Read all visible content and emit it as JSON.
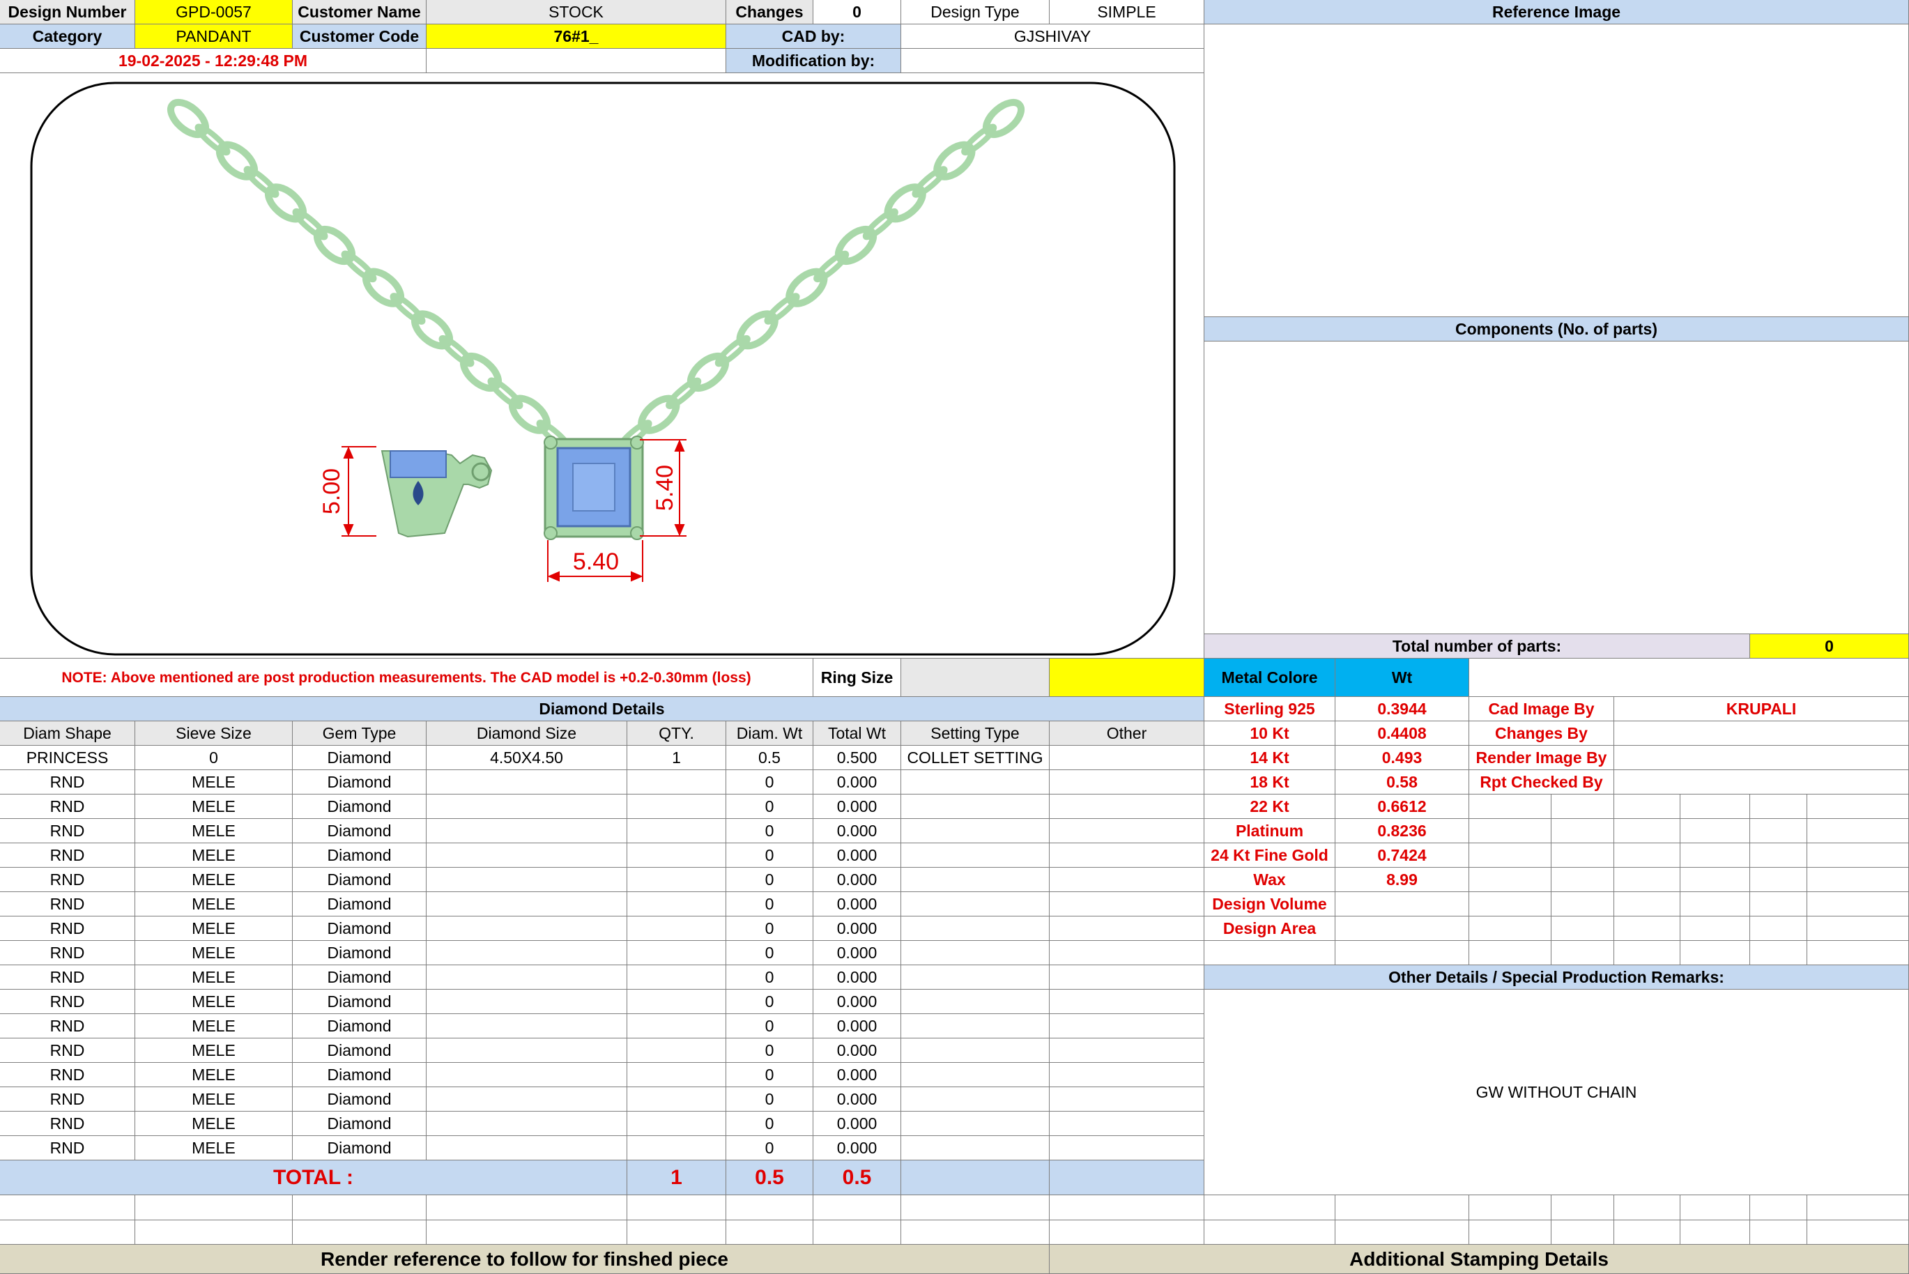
{
  "header": {
    "design_number_label": "Design Number",
    "design_number": "GPD-0057",
    "customer_name_label": "Customer Name",
    "customer_name": "STOCK",
    "changes_label": "Changes",
    "changes": "0",
    "design_type_label": "Design Type",
    "design_type": "SIMPLE",
    "category_label": "Category",
    "category": "PANDANT",
    "customer_code_label": "Customer Code",
    "customer_code": "76#1_",
    "cad_by_label": "CAD by:",
    "cad_by": "GJSHIVAY",
    "timestamp": "19-02-2025 - 12:29:48 PM",
    "modification_label": "Modification by:"
  },
  "drawing": {
    "dim_side": "5.00",
    "dim_height": "5.40",
    "dim_width": "5.40",
    "chain_color": "#a9d8a9",
    "stone_color": "#7aa3e8",
    "dim_color": "#e00000"
  },
  "right": {
    "reference_image": "Reference Image",
    "components": "Components (No. of parts)",
    "total_parts_label": "Total number of parts:",
    "total_parts": "0"
  },
  "note": "NOTE: Above mentioned are post production measurements. The CAD model is +0.2-0.30mm (loss)",
  "ring_size_label": "Ring Size",
  "diamond": {
    "title": "Diamond Details",
    "headers": [
      "Diam Shape",
      "Sieve Size",
      "Gem Type",
      "Diamond Size",
      "QTY.",
      "Diam. Wt",
      "Total Wt",
      "Setting Type",
      "Other"
    ],
    "rows": [
      [
        "PRINCESS",
        "0",
        "Diamond",
        "4.50X4.50",
        "1",
        "0.5",
        "0.500",
        "COLLET SETTING",
        ""
      ],
      [
        "RND",
        "MELE",
        "Diamond",
        "",
        "",
        "0",
        "0.000",
        "",
        ""
      ],
      [
        "RND",
        "MELE",
        "Diamond",
        "",
        "",
        "0",
        "0.000",
        "",
        ""
      ],
      [
        "RND",
        "MELE",
        "Diamond",
        "",
        "",
        "0",
        "0.000",
        "",
        ""
      ],
      [
        "RND",
        "MELE",
        "Diamond",
        "",
        "",
        "0",
        "0.000",
        "",
        ""
      ],
      [
        "RND",
        "MELE",
        "Diamond",
        "",
        "",
        "0",
        "0.000",
        "",
        ""
      ],
      [
        "RND",
        "MELE",
        "Diamond",
        "",
        "",
        "0",
        "0.000",
        "",
        ""
      ],
      [
        "RND",
        "MELE",
        "Diamond",
        "",
        "",
        "0",
        "0.000",
        "",
        ""
      ],
      [
        "RND",
        "MELE",
        "Diamond",
        "",
        "",
        "0",
        "0.000",
        "",
        ""
      ],
      [
        "RND",
        "MELE",
        "Diamond",
        "",
        "",
        "0",
        "0.000",
        "",
        ""
      ],
      [
        "RND",
        "MELE",
        "Diamond",
        "",
        "",
        "0",
        "0.000",
        "",
        ""
      ],
      [
        "RND",
        "MELE",
        "Diamond",
        "",
        "",
        "0",
        "0.000",
        "",
        ""
      ],
      [
        "RND",
        "MELE",
        "Diamond",
        "",
        "",
        "0",
        "0.000",
        "",
        ""
      ],
      [
        "RND",
        "MELE",
        "Diamond",
        "",
        "",
        "0",
        "0.000",
        "",
        ""
      ],
      [
        "RND",
        "MELE",
        "Diamond",
        "",
        "",
        "0",
        "0.000",
        "",
        ""
      ],
      [
        "RND",
        "MELE",
        "Diamond",
        "",
        "",
        "0",
        "0.000",
        "",
        ""
      ],
      [
        "RND",
        "MELE",
        "Diamond",
        "",
        "",
        "0",
        "0.000",
        "",
        ""
      ]
    ],
    "total_label": "TOTAL :",
    "total_qty": "1",
    "total_diam_wt": "0.5",
    "total_wt": "0.5"
  },
  "metal": {
    "header_color": "Metal Colore",
    "header_wt": "Wt",
    "rows": [
      [
        "Sterling 925",
        "0.3944"
      ],
      [
        "10 Kt",
        "0.4408"
      ],
      [
        "14 Kt",
        "0.493"
      ],
      [
        "18 Kt",
        "0.58"
      ],
      [
        "22 Kt",
        "0.6612"
      ],
      [
        "Platinum",
        "0.8236"
      ],
      [
        "24 Kt Fine Gold",
        "0.7424"
      ],
      [
        "Wax",
        "8.99"
      ],
      [
        "Design Volume",
        ""
      ],
      [
        "Design Area",
        ""
      ]
    ]
  },
  "credits": [
    [
      "Cad Image By",
      "KRUPALI"
    ],
    [
      "Changes By",
      ""
    ],
    [
      "Render Image By",
      ""
    ],
    [
      "Rpt Checked By",
      ""
    ]
  ],
  "remarks": {
    "title": "Other Details / Special Production Remarks:",
    "text": "GW WITHOUT CHAIN"
  },
  "footer": {
    "render_reference": "Render reference to follow for finshed piece",
    "stamping": "Additional Stamping Details"
  }
}
